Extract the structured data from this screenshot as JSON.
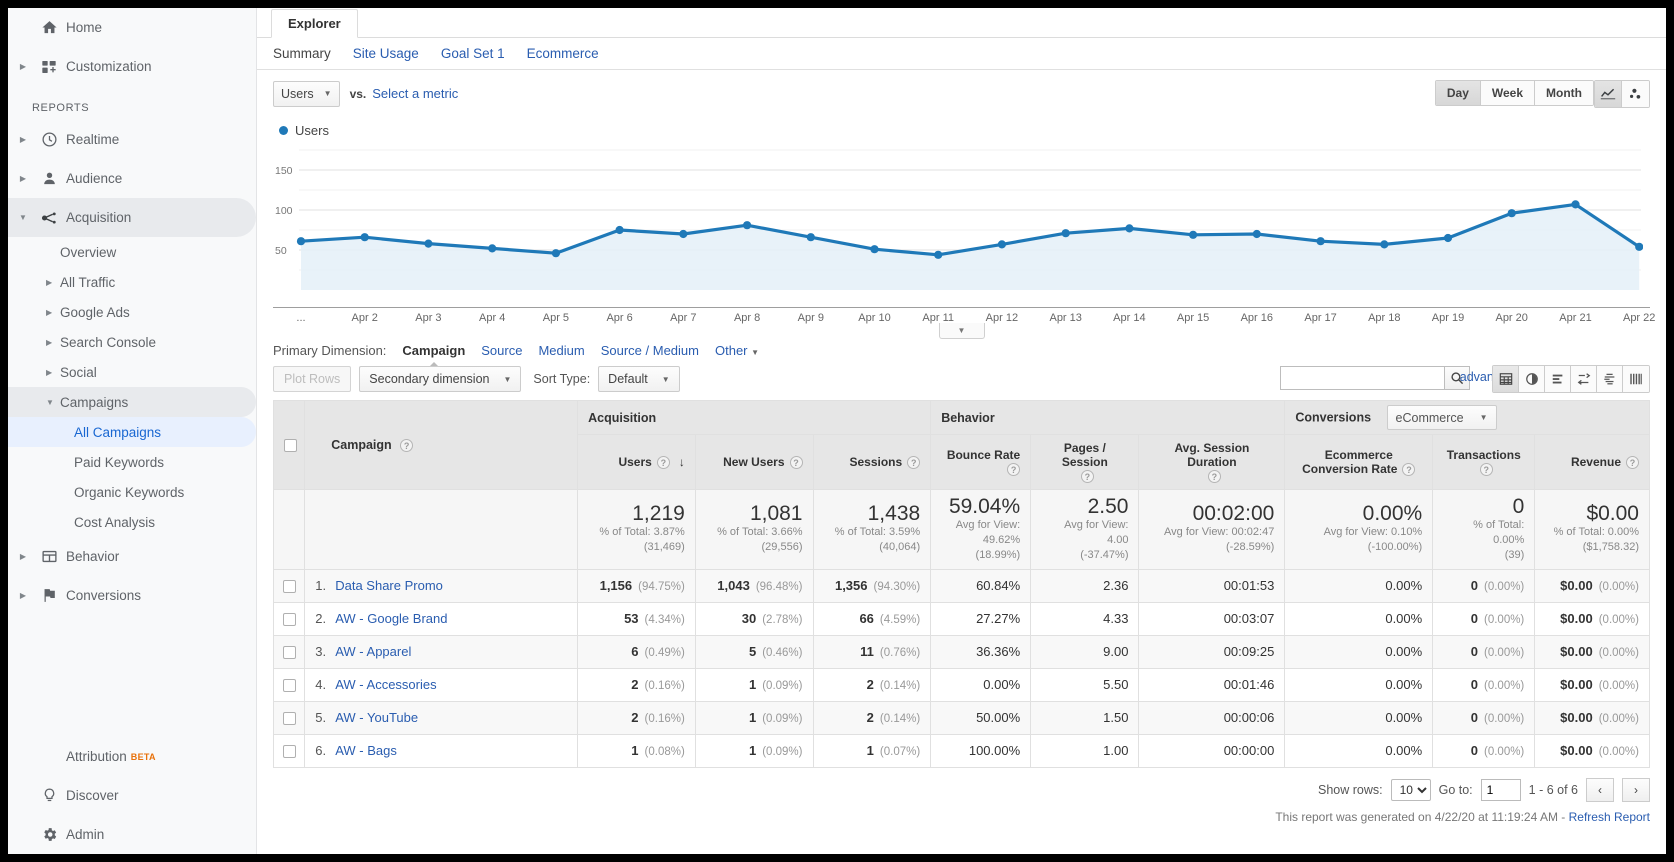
{
  "sidebar": {
    "top_items": [
      {
        "label": "Home",
        "icon": "home-icon",
        "expandable": false
      },
      {
        "label": "Customization",
        "icon": "customization-icon",
        "expandable": true
      }
    ],
    "section_label": "REPORTS",
    "report_items": [
      {
        "label": "Realtime",
        "icon": "clock-icon",
        "expandable": true,
        "selected": false
      },
      {
        "label": "Audience",
        "icon": "person-icon",
        "expandable": true,
        "selected": false
      },
      {
        "label": "Acquisition",
        "icon": "acquisition-icon",
        "expandable": true,
        "selected": true
      }
    ],
    "acquisition_children": [
      {
        "label": "Overview",
        "caret": false
      },
      {
        "label": "All Traffic",
        "caret": true
      },
      {
        "label": "Google Ads",
        "caret": true
      },
      {
        "label": "Search Console",
        "caret": true
      },
      {
        "label": "Social",
        "caret": true
      },
      {
        "label": "Campaigns",
        "caret": true,
        "expanded": true
      }
    ],
    "campaign_children": [
      {
        "label": "All Campaigns",
        "active": true
      },
      {
        "label": "Paid Keywords",
        "active": false
      },
      {
        "label": "Organic Keywords",
        "active": false
      },
      {
        "label": "Cost Analysis",
        "active": false
      }
    ],
    "tail_items": [
      {
        "label": "Behavior",
        "icon": "behavior-icon",
        "expandable": true
      },
      {
        "label": "Conversions",
        "icon": "flag-icon",
        "expandable": true
      }
    ],
    "bottom_items": [
      {
        "label": "Attribution",
        "icon": "",
        "badge": "BETA"
      },
      {
        "label": "Discover",
        "icon": "bulb-icon",
        "badge": ""
      },
      {
        "label": "Admin",
        "icon": "gear-icon",
        "badge": ""
      }
    ]
  },
  "header": {
    "explorer_tab": "Explorer",
    "subtabs": [
      {
        "label": "Summary",
        "current": true
      },
      {
        "label": "Site Usage",
        "current": false
      },
      {
        "label": "Goal Set 1",
        "current": false
      },
      {
        "label": "Ecommerce",
        "current": false
      }
    ]
  },
  "metricbar": {
    "metric": "Users",
    "vs": "vs.",
    "select_metric": "Select a metric",
    "granularity": [
      {
        "label": "Day",
        "on": true
      },
      {
        "label": "Week",
        "on": false
      },
      {
        "label": "Month",
        "on": false
      }
    ],
    "chart_types": [
      {
        "name": "line-chart-icon",
        "on": true
      },
      {
        "name": "motion-chart-icon",
        "on": false
      }
    ]
  },
  "chart_data": {
    "type": "area",
    "title": "",
    "legend": [
      "Users"
    ],
    "legend_position": "top-left",
    "series_color": "#1f79b8",
    "fill_color": "#e4f0f8",
    "grid": true,
    "xlabel": "",
    "ylabel": "",
    "ylim": [
      0,
      175
    ],
    "ytick_labels": [
      "50",
      "100",
      "150"
    ],
    "yticks": [
      50,
      100,
      150
    ],
    "x_leading_label": "...",
    "categories": [
      "Apr 2",
      "Apr 3",
      "Apr 4",
      "Apr 5",
      "Apr 6",
      "Apr 7",
      "Apr 8",
      "Apr 9",
      "Apr 10",
      "Apr 11",
      "Apr 12",
      "Apr 13",
      "Apr 14",
      "Apr 15",
      "Apr 16",
      "Apr 17",
      "Apr 18",
      "Apr 19",
      "Apr 20",
      "Apr 21",
      "Apr 22"
    ],
    "series": [
      {
        "name": "Users",
        "first_point_value": 61,
        "values": [
          66,
          58,
          52,
          46,
          75,
          70,
          81,
          66,
          51,
          44,
          57,
          71,
          77,
          69,
          70,
          61,
          57,
          65,
          96,
          107,
          54
        ]
      }
    ]
  },
  "primary_dimension": {
    "label": "Primary Dimension:",
    "options": [
      {
        "label": "Campaign",
        "current": true
      },
      {
        "label": "Source",
        "current": false
      },
      {
        "label": "Medium",
        "current": false
      },
      {
        "label": "Source / Medium",
        "current": false
      },
      {
        "label": "Other",
        "current": false,
        "has_caret": true
      }
    ]
  },
  "table_toolbar": {
    "plot_rows": "Plot Rows",
    "secondary_dimension": "Secondary dimension",
    "sort_type_label": "Sort Type:",
    "sort_type_value": "Default",
    "search_value": "",
    "search_placeholder": "",
    "search_icon": "search-icon",
    "advanced": "advanced",
    "view_icons": [
      {
        "name": "table-view-icon",
        "on": true
      },
      {
        "name": "percentage-view-icon",
        "on": false
      },
      {
        "name": "performance-view-icon",
        "on": false
      },
      {
        "name": "comparison-view-icon",
        "on": false
      },
      {
        "name": "term-cloud-view-icon",
        "on": false
      },
      {
        "name": "pivot-view-icon",
        "on": false
      }
    ]
  },
  "table": {
    "groups": [
      {
        "label": "Acquisition"
      },
      {
        "label": "Behavior"
      },
      {
        "label": "Conversions",
        "selector": "eCommerce"
      }
    ],
    "dimension_header": "Campaign",
    "columns": [
      {
        "label": "Users",
        "sorted": true,
        "sort_dir": "desc"
      },
      {
        "label": "New Users"
      },
      {
        "label": "Sessions"
      },
      {
        "label": "Bounce Rate"
      },
      {
        "label": "Pages / Session"
      },
      {
        "label": "Avg. Session Duration"
      },
      {
        "label": "Ecommerce Conversion Rate"
      },
      {
        "label": "Transactions"
      },
      {
        "label": "Revenue"
      }
    ],
    "summary": [
      {
        "value": "1,219",
        "line1": "% of Total: 3.87%",
        "line2": "(31,469)"
      },
      {
        "value": "1,081",
        "line1": "% of Total: 3.66%",
        "line2": "(29,556)"
      },
      {
        "value": "1,438",
        "line1": "% of Total: 3.59%",
        "line2": "(40,064)"
      },
      {
        "value": "59.04%",
        "line1": "Avg for View: 49.62%",
        "line2": "(18.99%)"
      },
      {
        "value": "2.50",
        "line1": "Avg for View: 4.00",
        "line2": "(-37.47%)"
      },
      {
        "value": "00:02:00",
        "line1": "Avg for View: 00:02:47",
        "line2": "(-28.59%)"
      },
      {
        "value": "0.00%",
        "line1": "Avg for View: 0.10%",
        "line2": "(-100.00%)"
      },
      {
        "value": "0",
        "line1": "% of Total: 0.00%",
        "line2": "(39)"
      },
      {
        "value": "$0.00",
        "line1": "% of Total: 0.00%",
        "line2": "($1,758.32)"
      }
    ],
    "rows": [
      {
        "index": "1.",
        "name": "Data Share Promo",
        "users": "1,156",
        "users_pct": "(94.75%)",
        "new_users": "1,043",
        "new_users_pct": "(96.48%)",
        "sessions": "1,356",
        "sessions_pct": "(94.30%)",
        "bounce": "60.84%",
        "pages": "2.36",
        "duration": "00:01:53",
        "ecr": "0.00%",
        "transactions": "0",
        "transactions_pct": "(0.00%)",
        "revenue": "$0.00",
        "revenue_pct": "(0.00%)"
      },
      {
        "index": "2.",
        "name": "AW - Google Brand",
        "users": "53",
        "users_pct": "(4.34%)",
        "new_users": "30",
        "new_users_pct": "(2.78%)",
        "sessions": "66",
        "sessions_pct": "(4.59%)",
        "bounce": "27.27%",
        "pages": "4.33",
        "duration": "00:03:07",
        "ecr": "0.00%",
        "transactions": "0",
        "transactions_pct": "(0.00%)",
        "revenue": "$0.00",
        "revenue_pct": "(0.00%)"
      },
      {
        "index": "3.",
        "name": "AW - Apparel",
        "users": "6",
        "users_pct": "(0.49%)",
        "new_users": "5",
        "new_users_pct": "(0.46%)",
        "sessions": "11",
        "sessions_pct": "(0.76%)",
        "bounce": "36.36%",
        "pages": "9.00",
        "duration": "00:09:25",
        "ecr": "0.00%",
        "transactions": "0",
        "transactions_pct": "(0.00%)",
        "revenue": "$0.00",
        "revenue_pct": "(0.00%)"
      },
      {
        "index": "4.",
        "name": "AW - Accessories",
        "users": "2",
        "users_pct": "(0.16%)",
        "new_users": "1",
        "new_users_pct": "(0.09%)",
        "sessions": "2",
        "sessions_pct": "(0.14%)",
        "bounce": "0.00%",
        "pages": "5.50",
        "duration": "00:01:46",
        "ecr": "0.00%",
        "transactions": "0",
        "transactions_pct": "(0.00%)",
        "revenue": "$0.00",
        "revenue_pct": "(0.00%)"
      },
      {
        "index": "5.",
        "name": "AW - YouTube",
        "users": "2",
        "users_pct": "(0.16%)",
        "new_users": "1",
        "new_users_pct": "(0.09%)",
        "sessions": "2",
        "sessions_pct": "(0.14%)",
        "bounce": "50.00%",
        "pages": "1.50",
        "duration": "00:00:06",
        "ecr": "0.00%",
        "transactions": "0",
        "transactions_pct": "(0.00%)",
        "revenue": "$0.00",
        "revenue_pct": "(0.00%)"
      },
      {
        "index": "6.",
        "name": "AW - Bags",
        "users": "1",
        "users_pct": "(0.08%)",
        "new_users": "1",
        "new_users_pct": "(0.09%)",
        "sessions": "1",
        "sessions_pct": "(0.07%)",
        "bounce": "100.00%",
        "pages": "1.00",
        "duration": "00:00:00",
        "ecr": "0.00%",
        "transactions": "0",
        "transactions_pct": "(0.00%)",
        "revenue": "$0.00",
        "revenue_pct": "(0.00%)"
      }
    ]
  },
  "footer": {
    "show_rows_label": "Show rows:",
    "show_rows_value": "10",
    "goto_label": "Go to:",
    "goto_value": "1",
    "range": "1 - 6 of 6",
    "prev": "‹",
    "next": "›",
    "generated_text": "This report was generated on 4/22/20 at 11:19:24 AM -",
    "refresh": "Refresh Report"
  }
}
